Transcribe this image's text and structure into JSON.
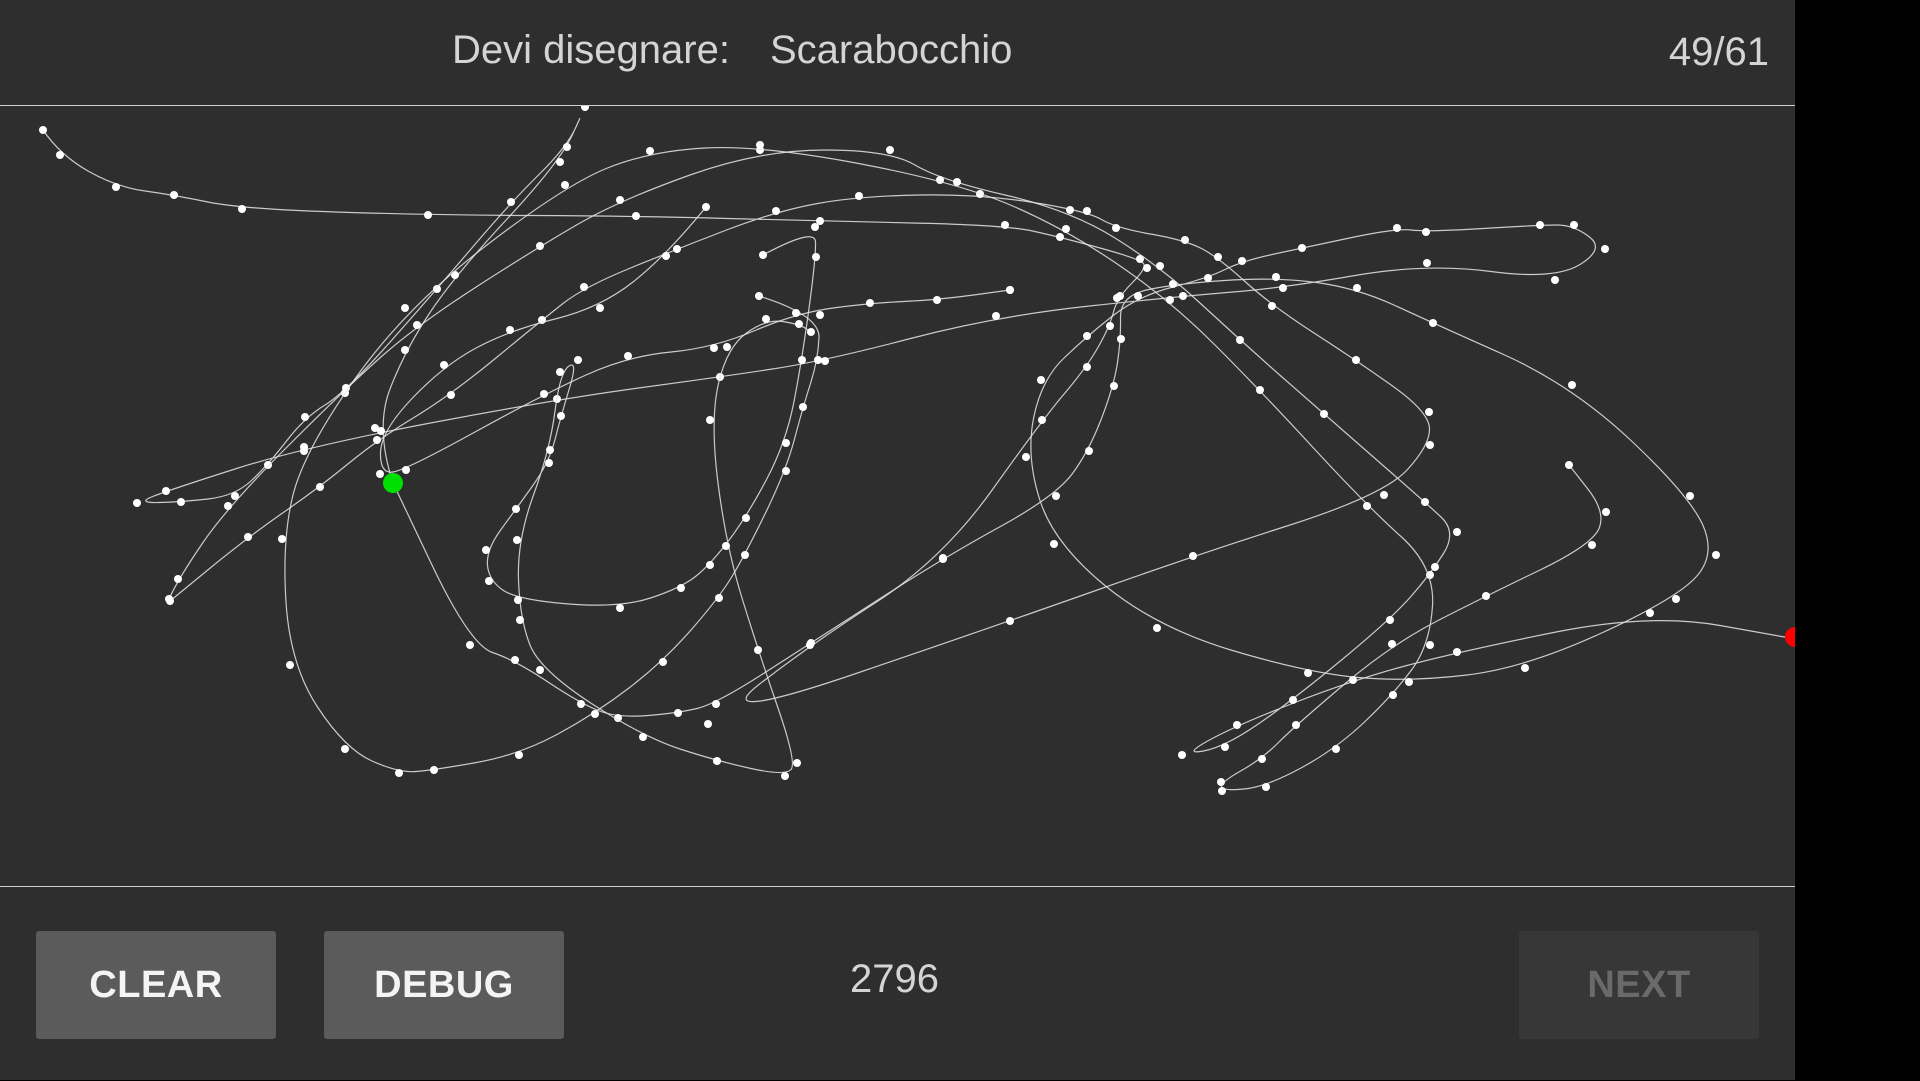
{
  "header": {
    "prompt_label": "Devi disegnare:",
    "prompt_word": "Scarabocchio",
    "progress": "49/61"
  },
  "canvas": {
    "start_marker_color": "#00e000",
    "end_marker_color": "#ff0000",
    "stroke_color": "#e6e6e6",
    "point_color": "#ffffff"
  },
  "footer": {
    "clear_label": "CLEAR",
    "debug_label": "DEBUG",
    "score": "2796",
    "next_label": "NEXT"
  }
}
